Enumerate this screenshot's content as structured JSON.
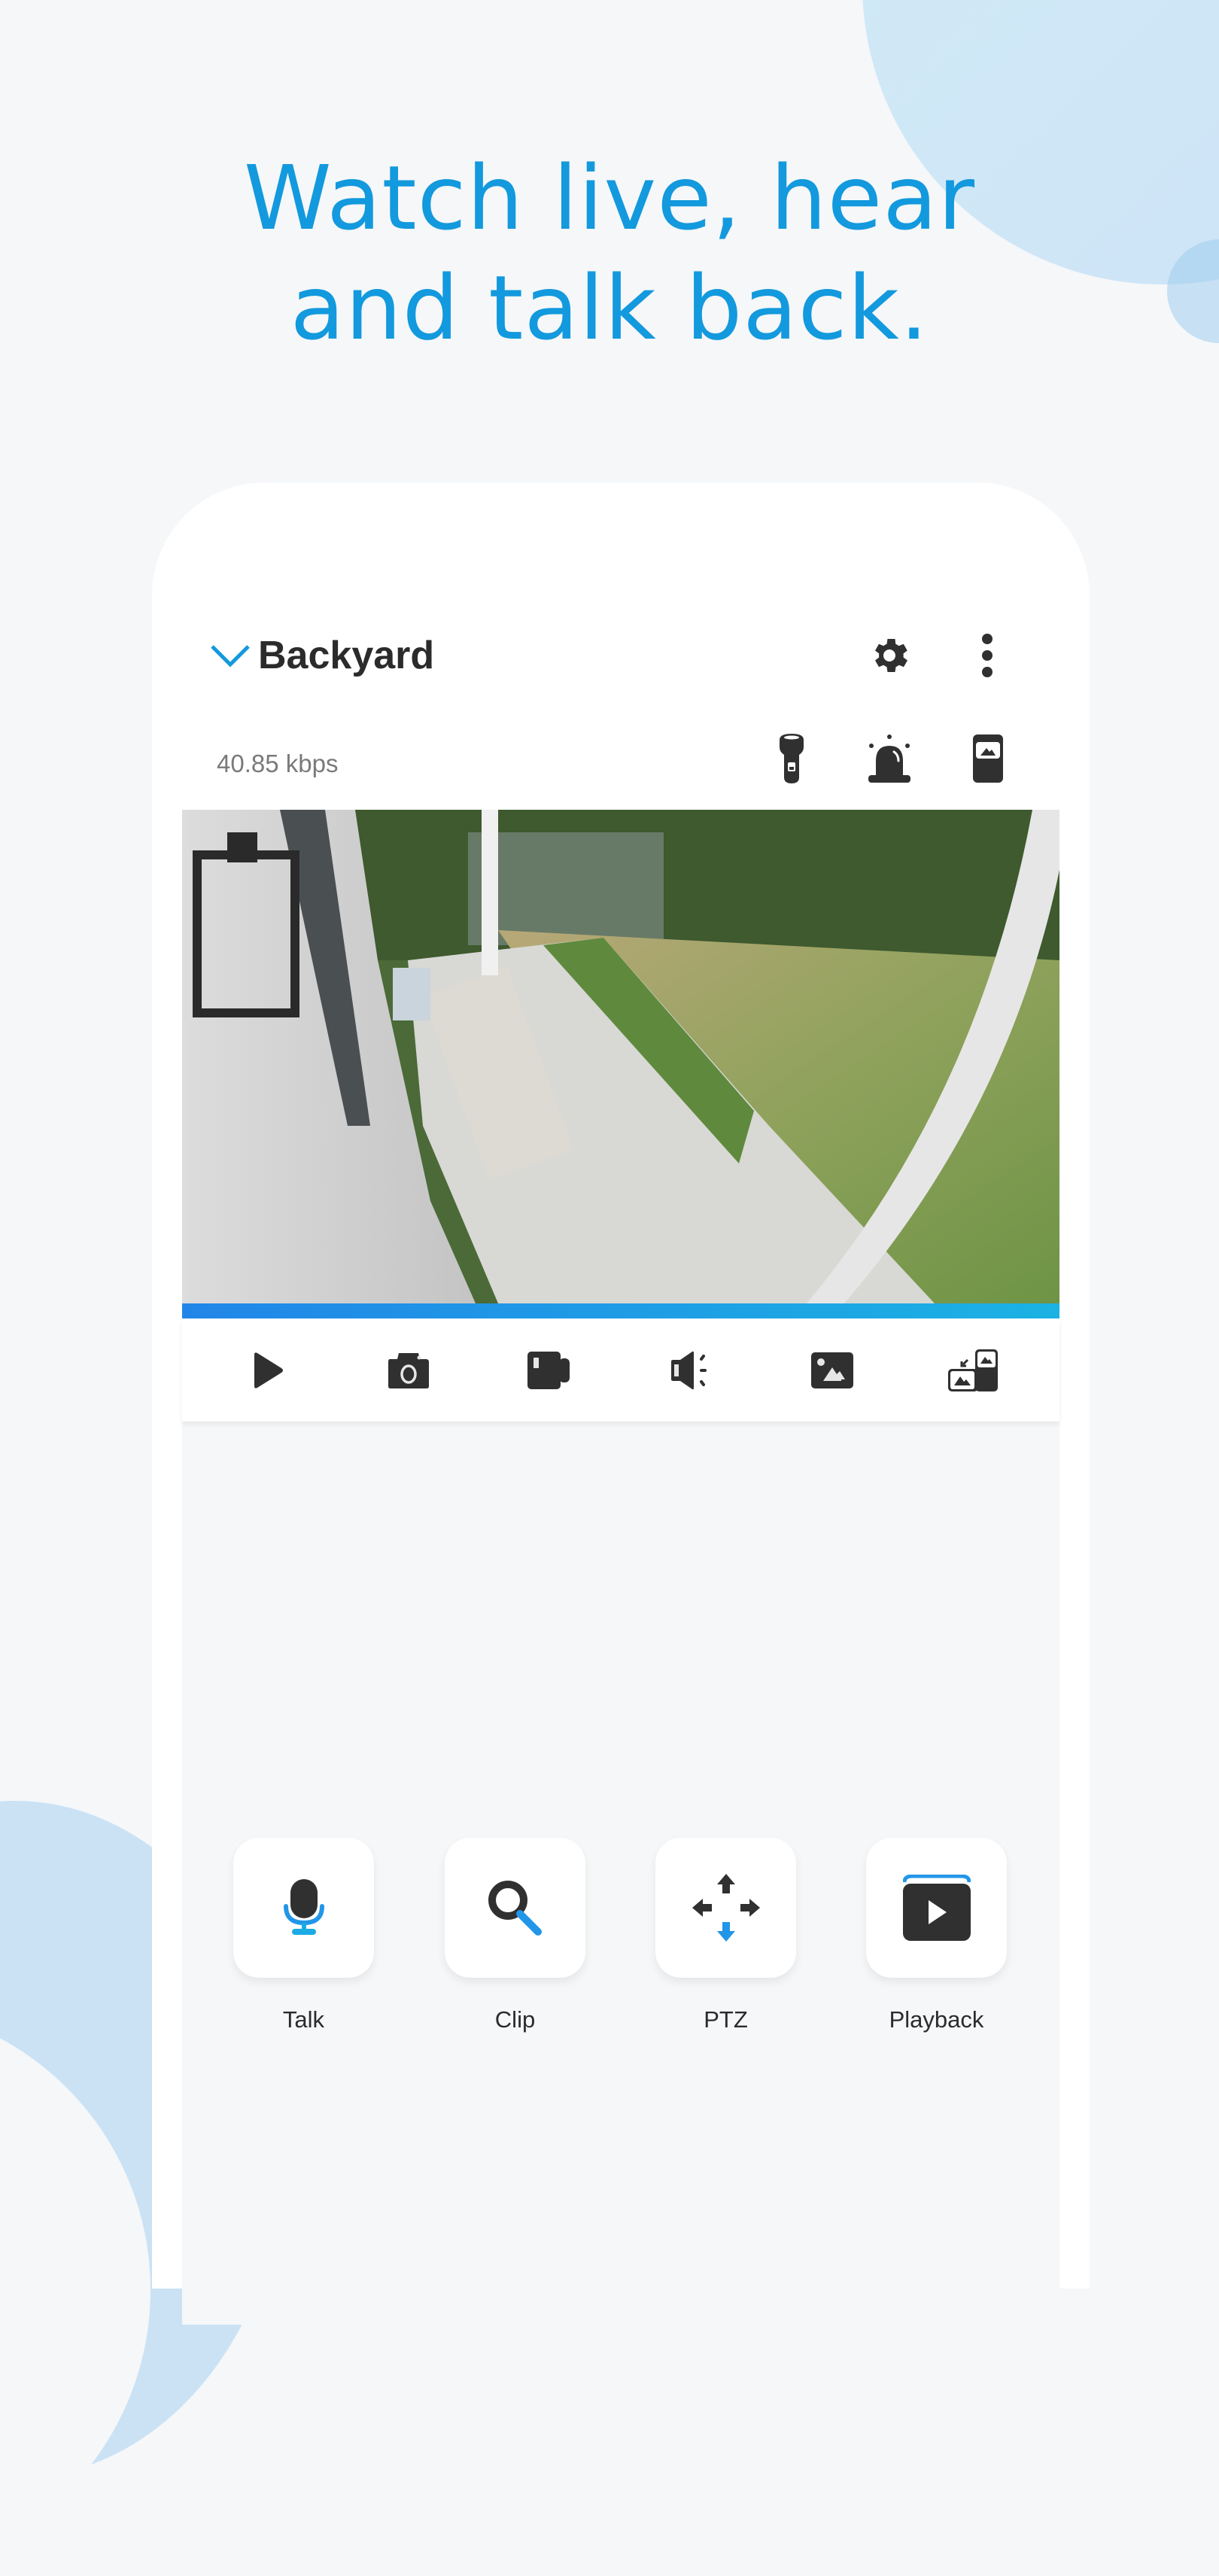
{
  "headline": {
    "line1": "Watch live, hear",
    "line2": "and talk back."
  },
  "camera": {
    "name": "Backyard",
    "bitrate": "40.85 kbps",
    "stream_progress_percent": 100
  },
  "header_icons": [
    {
      "name": "settings",
      "icon": "gear-icon"
    },
    {
      "name": "more",
      "icon": "more-vertical-icon"
    }
  ],
  "status_icons": [
    {
      "name": "spotlight",
      "icon": "flashlight-icon"
    },
    {
      "name": "siren",
      "icon": "siren-icon"
    },
    {
      "name": "display-mode",
      "icon": "portrait-image-icon"
    }
  ],
  "toolbar": [
    {
      "name": "play",
      "icon": "play-icon"
    },
    {
      "name": "snapshot",
      "icon": "camera-icon"
    },
    {
      "name": "record",
      "icon": "video-camera-icon"
    },
    {
      "name": "audio",
      "icon": "speaker-icon"
    },
    {
      "name": "gallery",
      "icon": "image-icon"
    },
    {
      "name": "switch-view",
      "icon": "swap-view-icon"
    }
  ],
  "actions": [
    {
      "label": "Talk",
      "icon": "microphone-icon"
    },
    {
      "label": "Clip",
      "icon": "search-icon"
    },
    {
      "label": "PTZ",
      "icon": "move-arrows-icon"
    },
    {
      "label": "Playback",
      "icon": "playback-icon"
    }
  ],
  "colors": {
    "accent": "#1399dd",
    "icon_dark": "#303030",
    "background": "#f5f7f9",
    "progress_start": "#2186e8",
    "progress_end": "#1bb2e3"
  }
}
